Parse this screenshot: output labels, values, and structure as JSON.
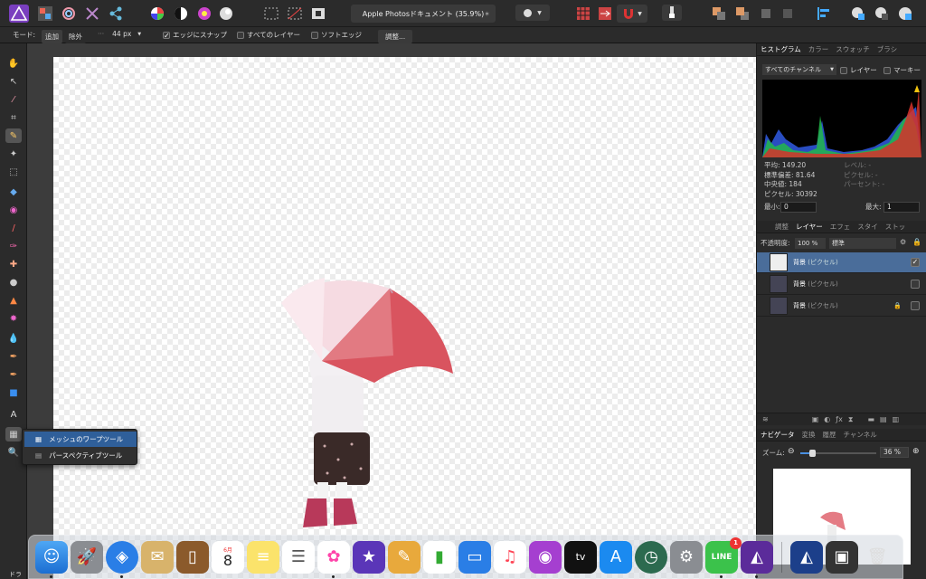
{
  "document_title": "Apple Photosドキュメント (35.9%)",
  "context": {
    "mode_label": "モード:",
    "add": "追加",
    "remove": "除外",
    "brush_size": "44 px",
    "snap_label": "エッジにスナップ",
    "all_layers_label": "すべてのレイヤー",
    "soft_edge_label": "ソフトエッジ",
    "adjust_button": "調整..."
  },
  "tool_popup": {
    "items": [
      "メッシュのワープツール",
      "パースペクティブツール"
    ],
    "selected": 0
  },
  "tool_partial_label": "ドラ",
  "histogram": {
    "tabs": [
      "ヒストグラム",
      "カラー",
      "スウォッチ",
      "ブラシ"
    ],
    "channel": "すべてのチャンネル",
    "layer_label": "レイヤー",
    "marquee_label": "マーキー",
    "mean": "平均: 149.20",
    "stddev": "標準偏差: 81.64",
    "median": "中央値: 184",
    "pixels": "ピクセル: 30392",
    "level": "レベル: -",
    "pixel": "ピクセル: -",
    "percent": "パーセント: -",
    "min_label": "最小:",
    "min_value": "0",
    "max_label": "最大:",
    "max_value": "1"
  },
  "layers": {
    "tabs": [
      "調整",
      "レイヤー",
      "エフェ",
      "スタイ",
      "ストッ"
    ],
    "opacity_label": "不透明度:",
    "opacity_value": "100 %",
    "blend_mode": "標準",
    "items": [
      {
        "name": "背景",
        "type": "(ピクセル)",
        "checked": true
      },
      {
        "name": "背景",
        "type": "(ピクセル)",
        "checked": false
      },
      {
        "name": "背景",
        "type": "(ピクセル)",
        "checked": false
      }
    ]
  },
  "navigator": {
    "tabs": [
      "ナビゲータ",
      "変換",
      "履歴",
      "チャンネル"
    ],
    "zoom_label": "ズーム:",
    "zoom_value": "36 %"
  },
  "dock": {
    "calendar_month": "6月",
    "calendar_day": "8",
    "line_label": "LINE",
    "line_badge": "1",
    "appletv_label": "tv"
  },
  "colors": {
    "accent": "#2f5f9a",
    "panel": "#2b2b2b",
    "toolbar": "#2b2b2b"
  }
}
